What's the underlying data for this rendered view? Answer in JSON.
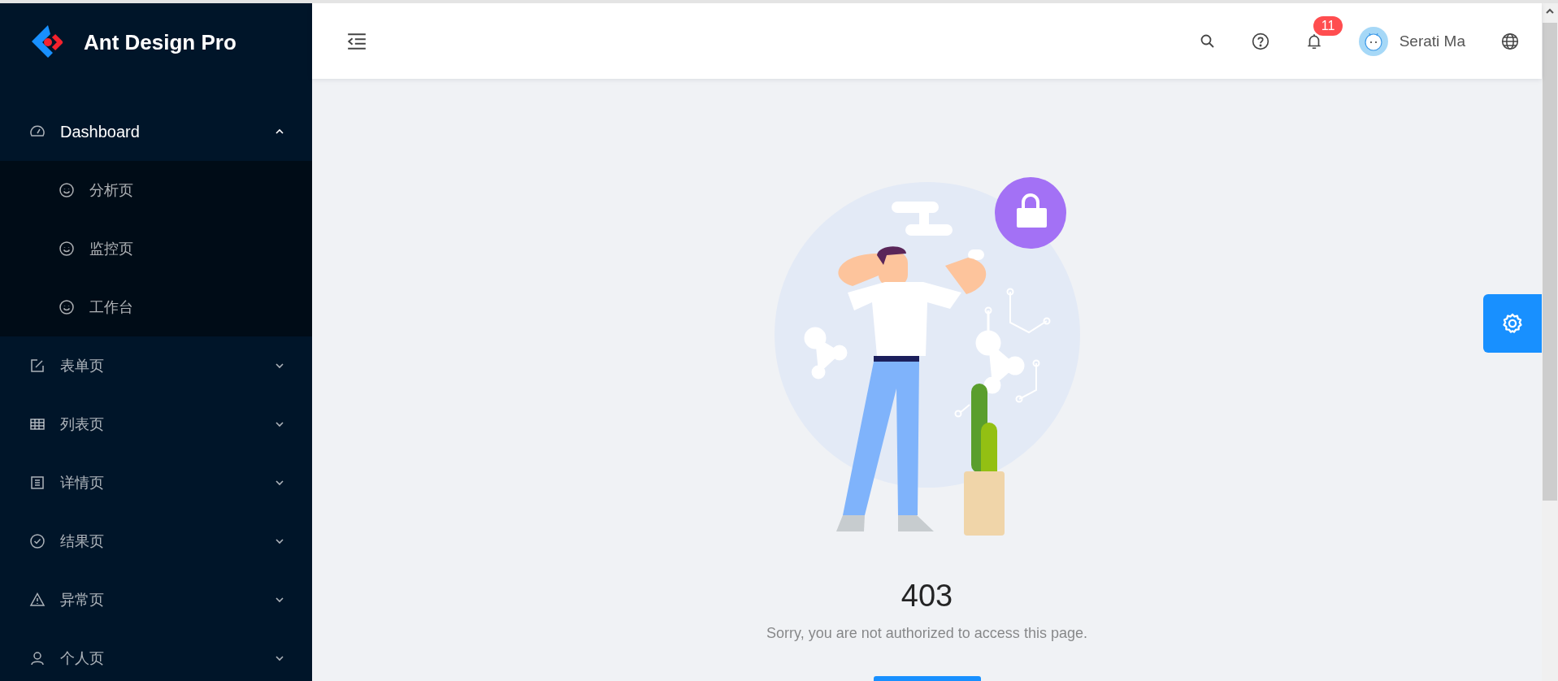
{
  "sidebar": {
    "logo_text": "Ant Design Pro",
    "menu": [
      {
        "label": "Dashboard",
        "kind": "dashboard",
        "expanded": true,
        "children": [
          {
            "label": "分析页",
            "selected": false
          },
          {
            "label": "监控页",
            "selected": false
          },
          {
            "label": "工作台",
            "selected": false
          }
        ]
      },
      {
        "label": "表单页",
        "kind": "form",
        "expanded": false
      },
      {
        "label": "列表页",
        "kind": "table",
        "expanded": false
      },
      {
        "label": "详情页",
        "kind": "profile",
        "expanded": false
      },
      {
        "label": "结果页",
        "kind": "check",
        "expanded": false
      },
      {
        "label": "异常页",
        "kind": "warning",
        "expanded": false
      },
      {
        "label": "个人页",
        "kind": "user",
        "expanded": false
      }
    ]
  },
  "header": {
    "notification_count": "11",
    "user_name": "Serati Ma"
  },
  "result": {
    "title": "403",
    "subtitle": "Sorry, you are not authorized to access this page."
  }
}
